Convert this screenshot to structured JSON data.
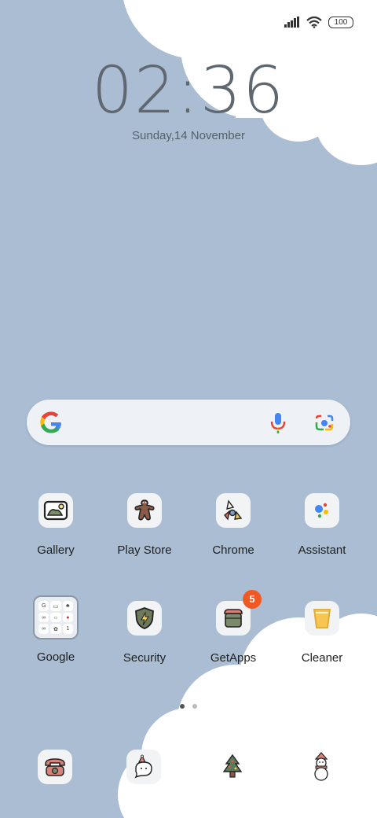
{
  "status_bar": {
    "battery": "100"
  },
  "lockclock": {
    "time": "02:36",
    "date": "Sunday,14 November"
  },
  "search": {
    "logo": "google-g-icon",
    "mic": "mic-icon",
    "lens": "lens-camera-icon"
  },
  "apps_row1": [
    {
      "label": "Gallery",
      "icon": "gallery-icon"
    },
    {
      "label": "Play Store",
      "icon": "gingerbread-icon"
    },
    {
      "label": "Chrome",
      "icon": "chrome-icon"
    },
    {
      "label": "Assistant",
      "icon": "assistant-icon"
    }
  ],
  "apps_row2": [
    {
      "label": "Google",
      "icon": "folder-icon"
    },
    {
      "label": "Security",
      "icon": "security-shield-icon"
    },
    {
      "label": "GetApps",
      "icon": "getapps-icon",
      "badge": "5"
    },
    {
      "label": "Cleaner",
      "icon": "cleaner-icon"
    }
  ],
  "page_indicator": {
    "pages": 2,
    "current": 1
  },
  "dock": [
    "phone-icon",
    "messages-icon",
    "tree-icon",
    "snowman-icon"
  ]
}
